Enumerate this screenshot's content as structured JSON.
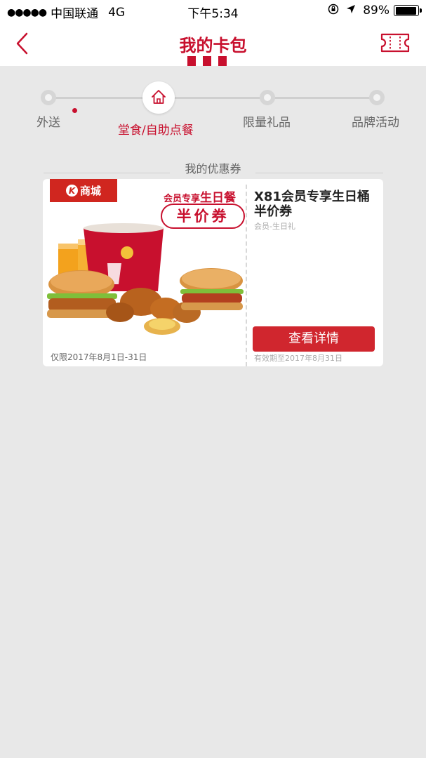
{
  "status_bar": {
    "signal_dots": "●●●●●",
    "carrier": "中国联通",
    "network": "4G",
    "time": "下午5:34",
    "battery_percent": "89%",
    "battery_level": 0.89
  },
  "header": {
    "title": "我的卡包"
  },
  "tabs": [
    {
      "label": "外送",
      "active": false
    },
    {
      "label": "堂食/自助点餐",
      "active": true
    },
    {
      "label": "限量礼品",
      "active": false
    },
    {
      "label": "品牌活动",
      "active": false
    }
  ],
  "section_title": "我的优惠券",
  "coupon": {
    "badge": "商城",
    "badge_logo": "K",
    "promo_prefix": "会员专享",
    "promo_highlight": "生日餐",
    "promo_pill": "半价券",
    "valid_left": "仅限2017年8月1日-31日",
    "name": "X81会员专享生日桶半价券",
    "subtitle": "会员-生日礼",
    "detail_button": "查看详情",
    "valid_right": "有效期至2017年8月31日"
  },
  "colors": {
    "brand_red": "#c8102e",
    "background": "#e8e8e8"
  }
}
